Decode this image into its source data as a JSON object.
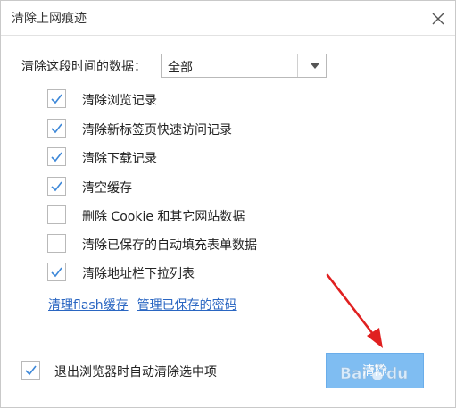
{
  "dialog": {
    "title": "清除上网痕迹"
  },
  "time_range": {
    "label": "清除这段时间的数据：",
    "selected": "全部"
  },
  "options": [
    {
      "label": "清除浏览记录",
      "checked": true
    },
    {
      "label": "清除新标签页快速访问记录",
      "checked": true
    },
    {
      "label": "清除下载记录",
      "checked": true
    },
    {
      "label": "清空缓存",
      "checked": true
    },
    {
      "label": "删除 Cookie 和其它网站数据",
      "checked": false
    },
    {
      "label": "清除已保存的自动填充表单数据",
      "checked": false
    },
    {
      "label": "清除地址栏下拉列表",
      "checked": true
    }
  ],
  "links": {
    "flash_cache": "清理flash缓存",
    "saved_passwords": "管理已保存的密码"
  },
  "auto_clear": {
    "label": "退出浏览器时自动清除选中项",
    "checked": true
  },
  "clear_button": {
    "label": "清除"
  },
  "colors": {
    "checkmark": "#3c87d8",
    "primary_button": "#7fbdf2",
    "link": "#2a66c2",
    "annotation_arrow": "#e02020"
  }
}
